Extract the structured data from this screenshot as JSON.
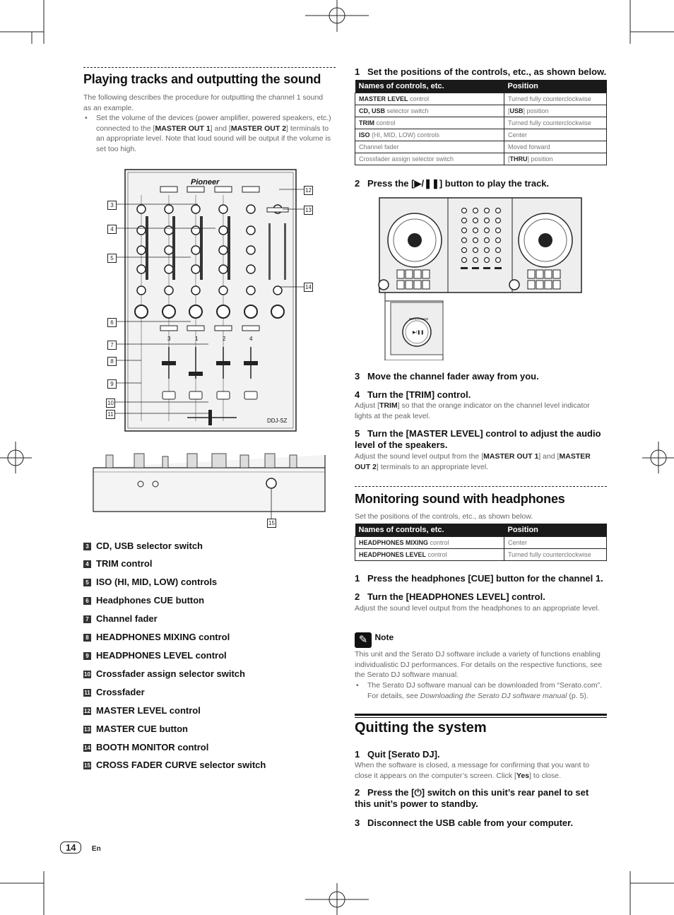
{
  "left": {
    "title": "Playing tracks and outputting the sound",
    "intro": "The following describes the procedure for outputting the channel 1 sound as an example.",
    "bullet": {
      "pre": "Set the volume of the devices (power amplifier, powered speakers, etc.) connected to the [",
      "b1": "MASTER OUT 1",
      "mid": "] and [",
      "b2": "MASTER OUT 2",
      "post": "] terminals to an appropriate level. Note that loud sound will be output if the volume is set too high."
    },
    "figure": {
      "brand": "Pioneer",
      "model": "DDJ-SZ",
      "channel_numbers": [
        "3",
        "1",
        "2",
        "4"
      ],
      "callouts_left": [
        "3",
        "4",
        "5",
        "6",
        "7",
        "8",
        "9",
        "10",
        "11"
      ],
      "callouts_right": [
        "12",
        "13",
        "14"
      ],
      "callout_front": "15"
    },
    "items": [
      {
        "num": "3",
        "label": "CD, USB selector switch"
      },
      {
        "num": "4",
        "label": "TRIM control"
      },
      {
        "num": "5",
        "label": "ISO (HI, MID, LOW) controls"
      },
      {
        "num": "6",
        "label": "Headphones CUE button"
      },
      {
        "num": "7",
        "label": "Channel fader"
      },
      {
        "num": "8",
        "label": "HEADPHONES MIXING control"
      },
      {
        "num": "9",
        "label": "HEADPHONES LEVEL control"
      },
      {
        "num": "10",
        "label": "Crossfader assign selector switch"
      },
      {
        "num": "11",
        "label": "Crossfader"
      },
      {
        "num": "12",
        "label": "MASTER LEVEL control"
      },
      {
        "num": "13",
        "label": "MASTER CUE button"
      },
      {
        "num": "14",
        "label": "BOOTH MONITOR control"
      },
      {
        "num": "15",
        "label": "CROSS FADER CURVE selector switch"
      }
    ]
  },
  "right": {
    "step1": {
      "num": "1",
      "title": "Set the positions of the controls, etc., as shown below."
    },
    "table1": {
      "headers": [
        "Names of controls, etc.",
        "Position"
      ],
      "rows": [
        {
          "name_b": "MASTER LEVEL",
          "name": " control",
          "pos_pre": "Turned fully counterclockwise",
          "pos_b": "",
          "pos_post": ""
        },
        {
          "name_b": "CD, USB",
          "name": " selector switch",
          "pos_pre": "[",
          "pos_b": "USB",
          "pos_post": "] position"
        },
        {
          "name_b": "TRIM",
          "name": " control",
          "pos_pre": "Turned fully counterclockwise",
          "pos_b": "",
          "pos_post": ""
        },
        {
          "name_b": "ISO",
          "name": " (HI, MID, LOW) controls",
          "pos_pre": "Center",
          "pos_b": "",
          "pos_post": ""
        },
        {
          "name_b": "",
          "name": "Channel fader",
          "pos_pre": "Moved forward",
          "pos_b": "",
          "pos_post": ""
        },
        {
          "name_b": "",
          "name": "Crossfader assign selector switch",
          "pos_pre": "[",
          "pos_b": "THRU",
          "pos_post": "] position"
        }
      ]
    },
    "step2": {
      "num": "2",
      "title": "Press the [▶/❚❚] button to play the track."
    },
    "controller_figure": {
      "inset_label": "PLAY/PAUSE",
      "inset_button": "▶/❚❚"
    },
    "step3": {
      "num": "3",
      "title": "Move the channel fader away from you."
    },
    "step4": {
      "num": "4",
      "title": "Turn the [TRIM] control.",
      "pre": "Adjust [",
      "b": "TRIM",
      "post": "] so that the orange indicator on the channel level indicator lights at the peak level."
    },
    "step5": {
      "num": "5",
      "title": "Turn the [MASTER LEVEL] control to adjust the audio level of the speakers.",
      "pre": "Adjust the sound level output from the [",
      "b1": "MASTER OUT 1",
      "mid": "] and [",
      "b2": "MASTER OUT 2",
      "post": "] terminals to an appropriate level."
    },
    "monitor": {
      "title": "Monitoring sound with headphones",
      "intro": "Set the positions of the controls, etc., as shown below.",
      "headers": [
        "Names of controls, etc.",
        "Position"
      ],
      "rows": [
        {
          "name_b": "HEADPHONES MIXING",
          "name": " control",
          "pos": "Center"
        },
        {
          "name_b": "HEADPHONES LEVEL",
          "name": " control",
          "pos": "Turned fully counterclockwise"
        }
      ],
      "step1": {
        "num": "1",
        "title": "Press the headphones [CUE] button for the channel 1."
      },
      "step2": {
        "num": "2",
        "title": "Turn the [HEADPHONES LEVEL] control.",
        "text": "Adjust the sound level output from the headphones to an appropriate level."
      }
    },
    "note": {
      "icon": "pencil-icon",
      "title": "Note",
      "text": "This unit and the Serato DJ software include a variety of functions enabling individualistic DJ performances. For details on the respective functions, see the Serato DJ software manual.",
      "bullet_pre": "The Serato DJ software manual can be downloaded from “Serato.com”. For details, see ",
      "bullet_i": "Downloading the Serato DJ software manual",
      "bullet_post": " (p. 5)."
    },
    "quit": {
      "title": "Quitting the system",
      "step1": {
        "num": "1",
        "title": "Quit [Serato DJ].",
        "pre": "When the software is closed, a message for confirming that you want to close it appears on the computer’s screen. Click [",
        "b": "Yes",
        "post": "] to close."
      },
      "step2": {
        "num": "2",
        "title": "Press the [⏻] switch on this unit’s rear panel to set this unit’s power to standby."
      },
      "step3": {
        "num": "3",
        "title": "Disconnect the USB cable from your computer."
      }
    }
  },
  "footer": {
    "page": "14",
    "lang": "En"
  }
}
